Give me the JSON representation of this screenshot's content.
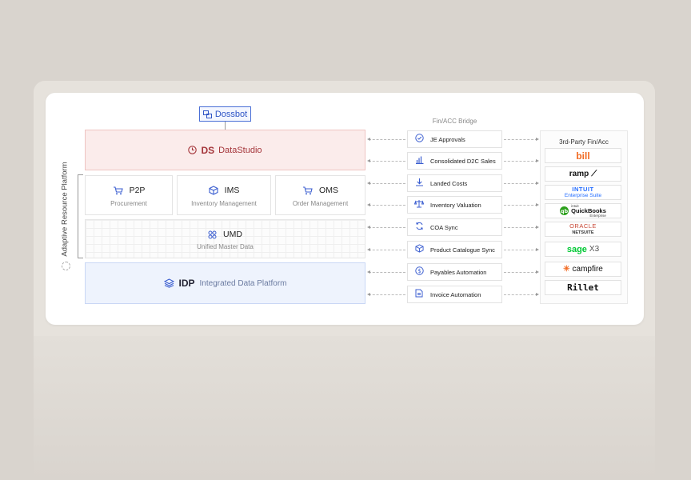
{
  "diagram": {
    "side_label": "Adaptive Resource Platform",
    "dossbot": {
      "label": "Dossbot",
      "icon": "bot-icon"
    },
    "datastudio": {
      "abbr": "DS",
      "name": "DataStudio"
    },
    "modules": [
      {
        "abbr": "P2P",
        "name": "Procurement",
        "icon": "cart-icon"
      },
      {
        "abbr": "IMS",
        "name": "Inventory Management",
        "icon": "box-icon"
      },
      {
        "abbr": "OMS",
        "name": "Order Management",
        "icon": "shopping-cart-icon"
      }
    ],
    "umd": {
      "abbr": "UMD",
      "name": "Unified Master Data"
    },
    "idp": {
      "abbr": "IDP",
      "name": "Integrated Data Platform"
    },
    "bridge": {
      "title": "Fin/ACC Bridge",
      "items": [
        {
          "label": "JE Approvals",
          "icon": "check-circle-icon"
        },
        {
          "label": "Consolidated D2C Sales",
          "icon": "bar-chart-icon"
        },
        {
          "label": "Landed Costs",
          "icon": "download-icon"
        },
        {
          "label": "Inventory Valuation",
          "icon": "scale-icon"
        },
        {
          "label": "COA Sync",
          "icon": "sync-icon"
        },
        {
          "label": "Product Catalogue Sync",
          "icon": "cube-icon"
        },
        {
          "label": "Payables Automation",
          "icon": "dollar-circle-icon"
        },
        {
          "label": "Invoice Automation",
          "icon": "invoice-icon"
        }
      ]
    },
    "third_party": {
      "title": "3rd-Party Fin/Acc",
      "vendors": [
        {
          "name": "bill",
          "color": "#f26a21"
        },
        {
          "name": "ramp",
          "color": "#111111"
        },
        {
          "name": "INTUIT",
          "sub": "Enterprise Suite",
          "color": "#236cff"
        },
        {
          "name": "QuickBooks",
          "pre": "intuit",
          "sub": "Enterprise",
          "color": "#2ca01c"
        },
        {
          "name": "ORACLE",
          "sub": "NETSUITE",
          "color": "#c74634"
        },
        {
          "name": "sage",
          "sub": "X3",
          "color": "#00d639"
        },
        {
          "name": "campfire",
          "color": "#f26a21"
        },
        {
          "name": "Rillet",
          "color": "#111111"
        }
      ]
    },
    "colors": {
      "accent": "#3b5ed0",
      "datastudio": "#a4353a",
      "idp_bg": "#eef3fd"
    }
  }
}
